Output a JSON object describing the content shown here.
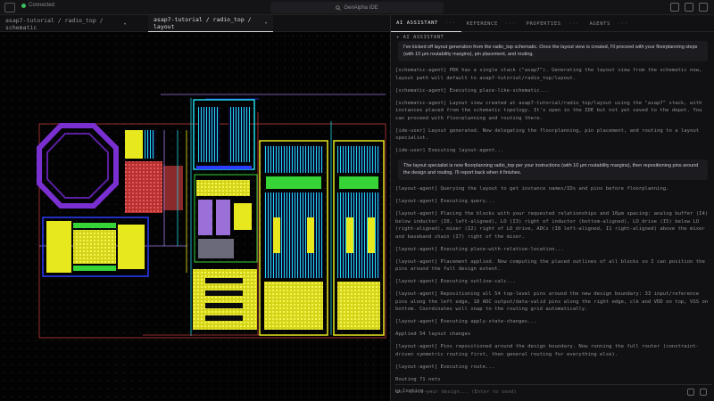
{
  "titlebar": {
    "status": "Connected",
    "status_color": "#3fbf5f",
    "app_title": "GenAlpha IDE",
    "app_icon": "search-icon"
  },
  "tabs": [
    {
      "label": "asap7-tutorial / radio_top / schematic",
      "modified": "•"
    },
    {
      "label": "asap7-tutorial / radio_top / layout",
      "modified": "•"
    }
  ],
  "panel": {
    "tabs": [
      "AI ASSISTANT",
      "REFERENCE",
      "PROPERTIES",
      "AGENTS"
    ],
    "tab_dots": "···",
    "header": "AI ASSISTANT",
    "messages": [
      {
        "type": "bubble",
        "text": "I've kicked off layout generation from the radio_top schematic. Once the layout view is created, I'll proceed with your floorplanning steps (with 10 µm routability margins), pin placement, and routing."
      },
      {
        "type": "log",
        "text": "[schematic-agent] PDK has a single stack (\"asap7\"). Generating the layout view from the schematic now, layout path will default to asap7-tutorial/radio_top/layout."
      },
      {
        "type": "log",
        "text": "[schematic-agent] Executing place-like-schematic..."
      },
      {
        "type": "log",
        "text": "[schematic-agent] Layout view created at asap7-tutorial/radio_top/layout using the \"asap7\" stack, with instances placed from the schematic topology. It's open in the IDE but not yet saved to the depot. You can proceed with floorplanning and routing there."
      },
      {
        "type": "log",
        "text": "[ide-user] Layout generated. Now delegating the floorplanning, pin placement, and routing to a layout specialist."
      },
      {
        "type": "log",
        "text": "[ide-user] Executing layout-agent..."
      },
      {
        "type": "bubble",
        "text": "The layout specialist is now floorplanning radio_top per your instructions (with 10 µm routability margins), then repositioning pins around the design and routing. I'll report back when it finishes."
      },
      {
        "type": "log",
        "text": "[layout-agent] Querying the layout to get instance names/IDs and pins before floorplanning."
      },
      {
        "type": "log",
        "text": "[layout-agent] Executing query..."
      },
      {
        "type": "log",
        "text": "[layout-agent] Placing the blocks with your requested relationships and 10µm spacing: analog buffer (I4) below inductor (I0, left-aligned), LO (I3) right of inductor (bottom-aligned), LO_drive (I5) below LO (right-aligned), mixer (I2) right of LO_drive, ADCs (I8 left-aligned, I1 right-aligned) above the mixer and baseband chain (I7) right of the mixer."
      },
      {
        "type": "log",
        "text": "[layout-agent] Executing place-with-relative-location..."
      },
      {
        "type": "log",
        "text": "[layout-agent] Placement applied. Now computing the placed outlines of all blocks so I can position the pins around the full design extent."
      },
      {
        "type": "log",
        "text": "[layout-agent] Executing outline-calc..."
      },
      {
        "type": "log",
        "text": "[layout-agent] Repositioning all 54 top-level pins around the new design boundary: 33 input/reference pins along the left edge, 18 ADC output/data-valid pins along the right edge, clk and VDD on top, VSS on bottom. Coordinates will snap to the routing grid automatically."
      },
      {
        "type": "log",
        "text": "[layout-agent] Executing apply-state-changes..."
      },
      {
        "type": "log",
        "text": "Applied 54 layout changes"
      },
      {
        "type": "log",
        "text": "[layout-agent] Pins repositioned around the design boundary. Now running the full router (constraint-driven symmetric routing first, then general routing for everything else)."
      },
      {
        "type": "log",
        "text": "[layout-agent] Executing route..."
      },
      {
        "type": "log",
        "text": "Routing 71 nets"
      }
    ],
    "thinking": "Cooking...",
    "composer_placeholder": "Ask about your design... (Enter to send)"
  },
  "layout_colors": {
    "inductor": "#7a2fd0",
    "block_outline": "#ff3b3b",
    "metal_yellow": "#e8e81e",
    "metal_cyan": "#1fd6e8",
    "metal_blue": "#2a3cff",
    "metal_green": "#36d436",
    "via_purple": "#9a6fd8"
  }
}
